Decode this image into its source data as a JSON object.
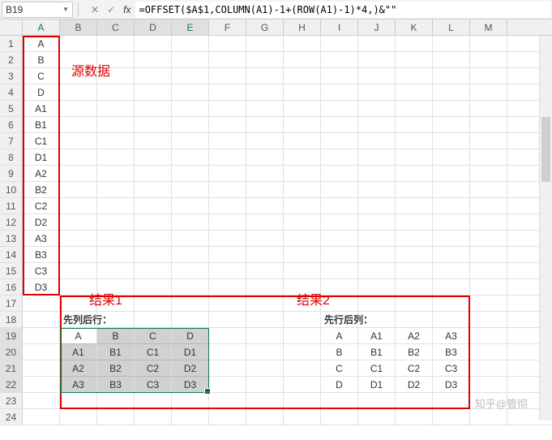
{
  "name_box": "B19",
  "formula": "=OFFSET($A$1,COLUMN(A1)-1+(ROW(A1)-1)*4,)&\"\"",
  "icons": {
    "cancel": "✕",
    "confirm": "✓",
    "fx": "fx"
  },
  "columns": [
    "A",
    "B",
    "C",
    "D",
    "E",
    "F",
    "G",
    "H",
    "I",
    "J",
    "K",
    "L",
    "M"
  ],
  "row_numbers": [
    "1",
    "2",
    "3",
    "4",
    "5",
    "6",
    "7",
    "8",
    "9",
    "10",
    "11",
    "12",
    "13",
    "14",
    "15",
    "16",
    "17",
    "18",
    "19",
    "20",
    "21",
    "22",
    "23",
    "24"
  ],
  "colA": [
    "A",
    "B",
    "C",
    "D",
    "A1",
    "B1",
    "C1",
    "D1",
    "A2",
    "B2",
    "C2",
    "D2",
    "A3",
    "B3",
    "C3",
    "D3"
  ],
  "labels": {
    "source": "源数据",
    "result1": "结果1",
    "result2": "结果2",
    "header_colrow": "先列后行：",
    "header_rowcol": "先行后列："
  },
  "result1": [
    [
      "A",
      "B",
      "C",
      "D"
    ],
    [
      "A1",
      "B1",
      "C1",
      "D1"
    ],
    [
      "A2",
      "B2",
      "C2",
      "D2"
    ],
    [
      "A3",
      "B3",
      "C3",
      "D3"
    ]
  ],
  "result2": [
    [
      "A",
      "A1",
      "A2",
      "A3"
    ],
    [
      "B",
      "B1",
      "B2",
      "B3"
    ],
    [
      "C",
      "C1",
      "C2",
      "C3"
    ],
    [
      "D",
      "D1",
      "D2",
      "D3"
    ]
  ],
  "watermark": "知乎@管彻"
}
